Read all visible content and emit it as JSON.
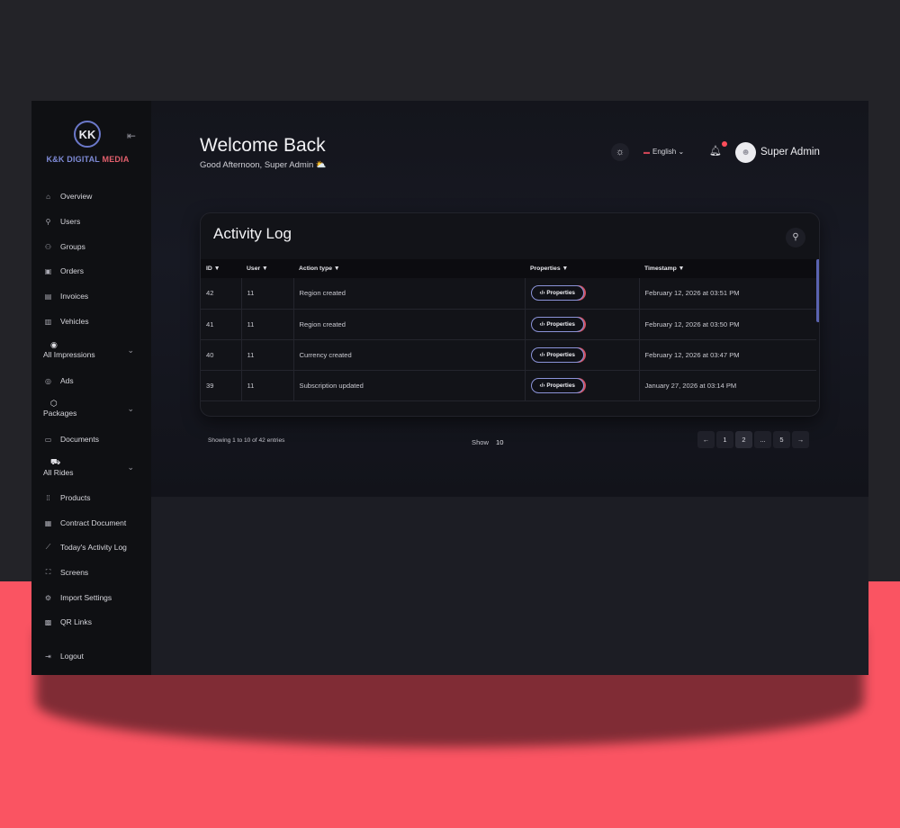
{
  "brand": {
    "logo_mark": "KK",
    "name_part1": "K&K DIGITAL ",
    "name_part2": "MEDIA"
  },
  "sidebar": {
    "items": [
      {
        "label": "Overview",
        "icon": "home-icon"
      },
      {
        "label": "Users",
        "icon": "user-icon"
      },
      {
        "label": "Groups",
        "icon": "users-icon"
      },
      {
        "label": "Orders",
        "icon": "bag-icon"
      },
      {
        "label": "Invoices",
        "icon": "invoice-icon"
      },
      {
        "label": "Vehicles",
        "icon": "truck-icon"
      },
      {
        "label": "All Impressions",
        "icon": "eye-icon"
      },
      {
        "label": "Ads",
        "icon": "target-icon"
      },
      {
        "label": "Packages",
        "icon": "box-icon"
      },
      {
        "label": "Documents",
        "icon": "document-icon"
      },
      {
        "label": "All Rides",
        "icon": "car-icon"
      },
      {
        "label": "Products",
        "icon": "grid-icon"
      },
      {
        "label": "Contract Document",
        "icon": "clipboard-icon"
      },
      {
        "label": "Today's Activity Log",
        "icon": "chart-icon"
      },
      {
        "label": "Screens",
        "icon": "screen-icon"
      },
      {
        "label": "Import Settings",
        "icon": "gear-icon"
      },
      {
        "label": "QR Links",
        "icon": "qr-icon"
      },
      {
        "label": "Logout",
        "icon": "logout-icon"
      }
    ]
  },
  "header": {
    "title": "Welcome Back",
    "greeting": "Good Afternoon, Super Admin ⛅",
    "language": "English",
    "user_name": "Super Admin"
  },
  "activity_log": {
    "title": "Activity Log",
    "columns": [
      "ID",
      "User",
      "Action type",
      "Properties",
      "Timestamp"
    ],
    "rows": [
      {
        "id": "42",
        "user": "11",
        "action": "Region created",
        "properties": "Properties",
        "timestamp": "February 12, 2026 at 03:51 PM"
      },
      {
        "id": "41",
        "user": "11",
        "action": "Region created",
        "properties": "Properties",
        "timestamp": "February 12, 2026 at 03:50 PM"
      },
      {
        "id": "40",
        "user": "11",
        "action": "Currency created",
        "properties": "Properties",
        "timestamp": "February 12, 2026 at 03:47 PM"
      },
      {
        "id": "39",
        "user": "11",
        "action": "Subscription updated",
        "properties": "Properties",
        "timestamp": "January 27, 2026 at 03:14 PM"
      }
    ],
    "entries_text": "Showing 1 to 10 of 42 entries",
    "show_label": "Show",
    "show_value": "10",
    "pagination": {
      "prev": "←",
      "pages": [
        "1",
        "2",
        "...",
        "5"
      ],
      "next": "→",
      "current": "2"
    }
  },
  "colors": {
    "accent": "#6b78c9",
    "brand_red": "#e25f6c",
    "background_bottom": "#fa5462"
  }
}
